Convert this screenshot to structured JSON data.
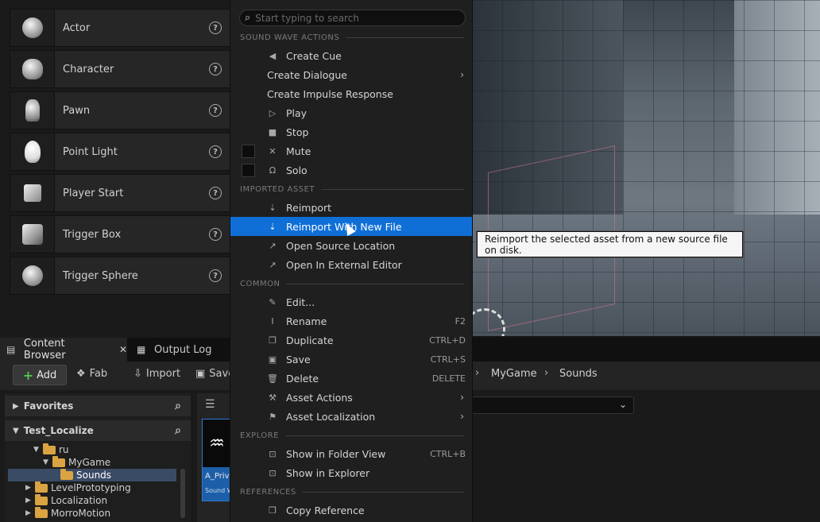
{
  "place_actors": {
    "items": [
      {
        "label": "Actor",
        "icon": "sphere-icon"
      },
      {
        "label": "Character",
        "icon": "character-icon"
      },
      {
        "label": "Pawn",
        "icon": "pawn-icon"
      },
      {
        "label": "Point Light",
        "icon": "lightbulb-icon"
      },
      {
        "label": "Player Start",
        "icon": "flag-icon"
      },
      {
        "label": "Trigger Box",
        "icon": "cube-icon"
      },
      {
        "label": "Trigger Sphere",
        "icon": "sphere-icon"
      }
    ],
    "help_glyph": "?"
  },
  "tabs": {
    "content_browser": "Content Browser",
    "close": "✕",
    "output_log": "Output Log"
  },
  "toolbar": {
    "add": "Add",
    "fab": "Fab",
    "import": "Import",
    "save": "Save"
  },
  "breadcrumb": [
    "MyGame",
    "Sounds"
  ],
  "sources": {
    "favorites": "Favorites",
    "project": "Test_Localize",
    "tree": [
      {
        "label": "ru"
      },
      {
        "label": "MyGame"
      },
      {
        "label": "Sounds"
      },
      {
        "label": "LevelPrototyping"
      },
      {
        "label": "Localization"
      },
      {
        "label": "MorroMotion"
      }
    ]
  },
  "asset": {
    "name": "A_Priv",
    "type": "Sound W"
  },
  "context_menu": {
    "search_placeholder": "Start typing to search",
    "sections": {
      "sound_wave_actions": "SOUND WAVE ACTIONS",
      "imported_asset": "IMPORTED ASSET",
      "common": "COMMON",
      "explore": "EXPLORE",
      "references": "REFERENCES"
    },
    "items": {
      "create_cue": "Create Cue",
      "create_dialogue": "Create Dialogue",
      "create_impulse_response": "Create Impulse Response",
      "play": "Play",
      "stop": "Stop",
      "mute": "Mute",
      "solo": "Solo",
      "reimport": "Reimport",
      "reimport_new_file": "Reimport With New File",
      "open_source_location": "Open Source Location",
      "open_external_editor": "Open In External Editor",
      "edit": "Edit...",
      "rename": "Rename",
      "rename_shortcut": "F2",
      "duplicate": "Duplicate",
      "duplicate_shortcut": "CTRL+D",
      "save": "Save",
      "save_shortcut": "CTRL+S",
      "delete": "Delete",
      "delete_shortcut": "DELETE",
      "asset_actions": "Asset Actions",
      "asset_localization": "Asset Localization",
      "show_in_folder_view": "Show in Folder View",
      "show_in_folder_view_shortcut": "CTRL+B",
      "show_in_explorer": "Show in Explorer",
      "copy_reference": "Copy Reference"
    }
  },
  "tooltip": "Reimport the selected asset from a new source file on disk.",
  "colors": {
    "highlight": "#0f6fd6",
    "add_plus": "#4fc84f",
    "folder": "#d9a441"
  }
}
